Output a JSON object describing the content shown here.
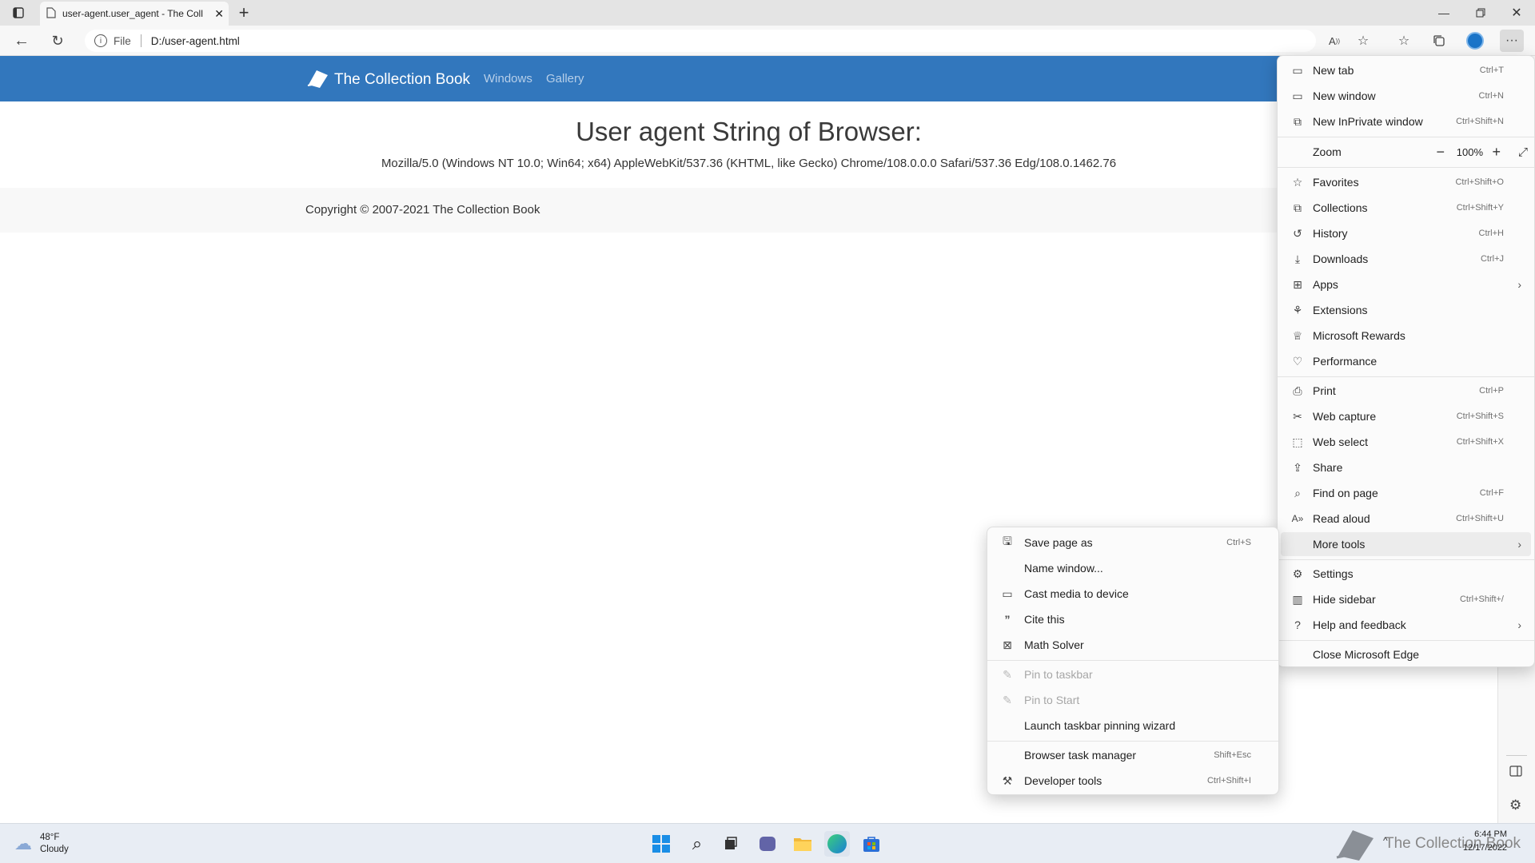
{
  "browser": {
    "tab": {
      "title": "user-agent.user_agent - The Coll"
    },
    "address": {
      "scheme": "File",
      "url": "D:/user-agent.html"
    }
  },
  "page": {
    "brand": "The Collection Book",
    "nav": [
      "Windows",
      "Gallery"
    ],
    "heading": "User agent String of Browser:",
    "ua": "Mozilla/5.0 (Windows NT 10.0; Win64; x64) AppleWebKit/537.36 (KHTML, like Gecko) Chrome/108.0.0.0 Safari/537.36 Edg/108.0.1462.76",
    "footer": "Copyright © 2007-2021 The Collection Book"
  },
  "menu": {
    "items": [
      {
        "label": "New tab",
        "shortcut": "Ctrl+T",
        "icon": "new-tab-icon"
      },
      {
        "label": "New window",
        "shortcut": "Ctrl+N",
        "icon": "new-window-icon"
      },
      {
        "label": "New InPrivate window",
        "shortcut": "Ctrl+Shift+N",
        "icon": "inprivate-icon"
      },
      {
        "label": "Favorites",
        "shortcut": "Ctrl+Shift+O",
        "icon": "favorites-icon"
      },
      {
        "label": "Collections",
        "shortcut": "Ctrl+Shift+Y",
        "icon": "collections-icon"
      },
      {
        "label": "History",
        "shortcut": "Ctrl+H",
        "icon": "history-icon"
      },
      {
        "label": "Downloads",
        "shortcut": "Ctrl+J",
        "icon": "downloads-icon"
      },
      {
        "label": "Apps",
        "shortcut": "",
        "icon": "apps-icon",
        "submenu": true
      },
      {
        "label": "Extensions",
        "shortcut": "",
        "icon": "extensions-icon"
      },
      {
        "label": "Microsoft Rewards",
        "shortcut": "",
        "icon": "rewards-icon"
      },
      {
        "label": "Performance",
        "shortcut": "",
        "icon": "performance-icon"
      },
      {
        "label": "Print",
        "shortcut": "Ctrl+P",
        "icon": "print-icon"
      },
      {
        "label": "Web capture",
        "shortcut": "Ctrl+Shift+S",
        "icon": "web-capture-icon"
      },
      {
        "label": "Web select",
        "shortcut": "Ctrl+Shift+X",
        "icon": "web-select-icon"
      },
      {
        "label": "Share",
        "shortcut": "",
        "icon": "share-icon"
      },
      {
        "label": "Find on page",
        "shortcut": "Ctrl+F",
        "icon": "find-icon"
      },
      {
        "label": "Read aloud",
        "shortcut": "Ctrl+Shift+U",
        "icon": "read-aloud-icon"
      },
      {
        "label": "More tools",
        "shortcut": "",
        "icon": "",
        "submenu": true
      },
      {
        "label": "Settings",
        "shortcut": "",
        "icon": "settings-icon"
      },
      {
        "label": "Hide sidebar",
        "shortcut": "Ctrl+Shift+/",
        "icon": "sidebar-icon"
      },
      {
        "label": "Help and feedback",
        "shortcut": "",
        "icon": "help-icon",
        "submenu": true
      },
      {
        "label": "Close Microsoft Edge",
        "shortcut": "",
        "icon": ""
      }
    ],
    "zoom": {
      "label": "Zoom",
      "value": "100%"
    }
  },
  "more_tools": {
    "items": [
      {
        "label": "Save page as",
        "shortcut": "Ctrl+S",
        "icon": "save-icon",
        "disabled": false
      },
      {
        "label": "Name window...",
        "shortcut": "",
        "icon": "",
        "disabled": false
      },
      {
        "label": "Cast media to device",
        "shortcut": "",
        "icon": "cast-icon",
        "disabled": false
      },
      {
        "label": "Cite this",
        "shortcut": "",
        "icon": "cite-icon",
        "disabled": false
      },
      {
        "label": "Math Solver",
        "shortcut": "",
        "icon": "math-solver-icon",
        "disabled": false
      },
      {
        "label": "Pin to taskbar",
        "shortcut": "",
        "icon": "pin-icon",
        "disabled": true
      },
      {
        "label": "Pin to Start",
        "shortcut": "",
        "icon": "pin-icon",
        "disabled": true
      },
      {
        "label": "Launch taskbar pinning wizard",
        "shortcut": "",
        "icon": "",
        "disabled": false
      },
      {
        "label": "Browser task manager",
        "shortcut": "Shift+Esc",
        "icon": "",
        "disabled": false
      },
      {
        "label": "Developer tools",
        "shortcut": "Ctrl+Shift+I",
        "icon": "devtools-icon",
        "disabled": false
      }
    ]
  },
  "taskbar": {
    "weather": {
      "temp": "48°F",
      "condition": "Cloudy"
    },
    "watermark": "The Collection Book",
    "time": "6:44 PM",
    "date": "12/17/2022"
  }
}
